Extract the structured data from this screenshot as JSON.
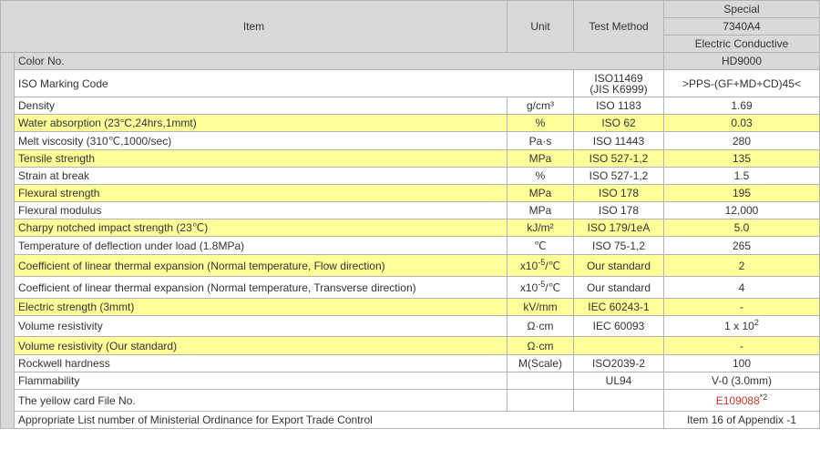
{
  "header": {
    "item": "Item",
    "unit": "Unit",
    "test_method": "Test Method",
    "grade_line1": "Special",
    "grade_line2": "7340A4",
    "grade_line3": "Electric Conductive"
  },
  "color_row": {
    "label": "Color No.",
    "value": "HD9000"
  },
  "iso_marking": {
    "label": "ISO Marking Code",
    "method_line1": "ISO11469",
    "method_line2": "(JIS K6999)",
    "value": ">PPS-(GF+MD+CD)45<"
  },
  "rows": [
    {
      "item": "Density",
      "unit": "g/cm³",
      "method": "ISO 1183",
      "value": "1.69"
    },
    {
      "item": "Water absorption (23°C,24hrs,1mmt)",
      "unit": "%",
      "method": "ISO 62",
      "value": "0.03"
    },
    {
      "item": "Melt viscosity (310℃,1000/sec)",
      "unit": "Pa·s",
      "method": "ISO 11443",
      "value": "280"
    },
    {
      "item": "Tensile strength",
      "unit": "MPa",
      "method": "ISO 527-1,2",
      "value": "135"
    },
    {
      "item": "Strain at break",
      "unit": "%",
      "method": "ISO 527-1,2",
      "value": "1.5"
    },
    {
      "item": "Flexural strength",
      "unit": "MPa",
      "method": "ISO 178",
      "value": "195"
    },
    {
      "item": "Flexural modulus",
      "unit": "MPa",
      "method": "ISO 178",
      "value": "12,000"
    },
    {
      "item": "Charpy notched impact strength (23℃)",
      "unit": "kJ/m²",
      "method": "ISO 179/1eA",
      "value": "5.0"
    },
    {
      "item": "Temperature of deflection under load (1.8MPa)",
      "unit": "℃",
      "method": "ISO 75-1,2",
      "value": "265"
    }
  ],
  "cte_flow": {
    "item": "Coefficient of linear thermal expansion (Normal temperature, Flow direction)",
    "unit_base": "x10",
    "unit_exp": "-5",
    "unit_tail": "/℃",
    "method": "Our standard",
    "value": "2"
  },
  "cte_trans": {
    "item": "Coefficient of linear thermal expansion (Normal temperature, Transverse direction)",
    "unit_base": "x10",
    "unit_exp": "-5",
    "unit_tail": "/℃",
    "method": "Our standard",
    "value": "4"
  },
  "electric_strength": {
    "item": "Electric strength (3mmt)",
    "unit": "kV/mm",
    "method": "IEC 60243-1",
    "value": "-"
  },
  "volume_resistivity": {
    "item": "Volume resistivity",
    "unit": "Ω·cm",
    "method": "IEC 60093",
    "value_base": "1 x 10",
    "value_exp": "2"
  },
  "volume_resistivity_own": {
    "item": "Volume resistivity (Our standard)",
    "unit": "Ω·cm",
    "method": "",
    "value": "-"
  },
  "rockwell": {
    "item": "Rockwell hardness",
    "unit": "M(Scale)",
    "method": "ISO2039-2",
    "value": "100"
  },
  "flammability": {
    "item": "Flammability",
    "unit": "",
    "method": "UL94",
    "value": "V-0 (3.0mm)"
  },
  "yellow_card": {
    "item": "The yellow card File No.",
    "link": "E109088",
    "note": "*2"
  },
  "export_list": {
    "item": "Appropriate List number of Ministerial Ordinance for Export Trade Control",
    "value": "Item 16 of Appendix -1"
  },
  "colors": {
    "header_bg": "#d9d9d9",
    "highlight_bg": "#ffff99",
    "link": "#c0392b",
    "border": "#b3b3b3"
  }
}
